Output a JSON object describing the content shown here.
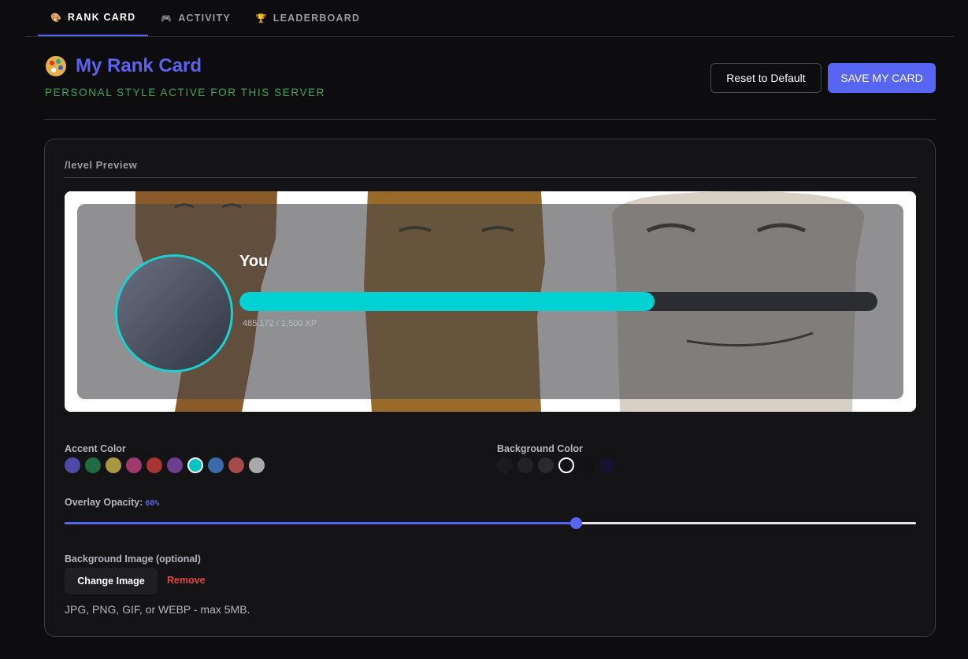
{
  "tabs": [
    {
      "label": "RANK CARD",
      "icon": "palette-icon",
      "glyph": "🎨",
      "active": true
    },
    {
      "label": "ACTIVITY",
      "icon": "gamepad-icon",
      "glyph": "🎮",
      "active": false
    },
    {
      "label": "LEADERBOARD",
      "icon": "trophy-icon",
      "glyph": "🏆",
      "active": false
    }
  ],
  "header": {
    "icon": "palette-icon",
    "title": "My Rank Card",
    "subtitle": "PERSONAL STYLE ACTIVE FOR THIS SERVER",
    "reset_label": "Reset to Default",
    "save_label": "SAVE MY CARD"
  },
  "preview": {
    "label": "/level Preview",
    "username": "You",
    "xp_text": "485,172 / 1,500 XP",
    "progress_fraction": 0.65
  },
  "accent": {
    "label": "Accent Color",
    "colors": [
      "#4d4aa8",
      "#1f6b44",
      "#a8983f",
      "#a03a6c",
      "#a83434",
      "#6b3f8e",
      "#00c4c4",
      "#3a6aa8",
      "#a84a4a",
      "#a9a9a9"
    ],
    "selected_index": 6
  },
  "background": {
    "label": "Background Color",
    "colors": [
      "#1b1b1e",
      "#222225",
      "#2a2a2d",
      "#141416",
      "#121214",
      "#15142a"
    ],
    "selected_index": 3
  },
  "opacity": {
    "label": "Overlay Opacity:",
    "value_text": "60%",
    "value": 0.6
  },
  "bg_image": {
    "label": "Background Image (optional)",
    "change_label": "Change Image",
    "remove_label": "Remove",
    "hint": "JPG, PNG, GIF, or WEBP - max 5MB."
  }
}
